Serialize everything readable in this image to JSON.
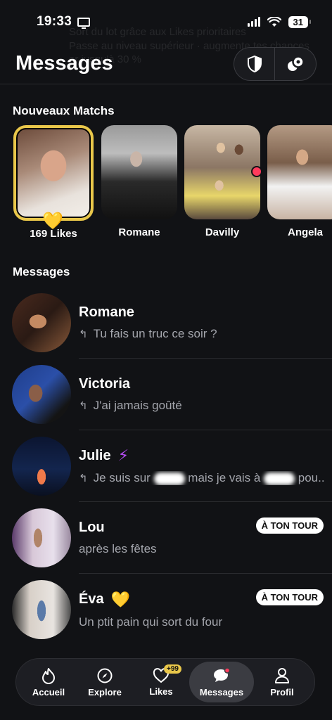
{
  "status_bar": {
    "time": "19:33",
    "battery": "31"
  },
  "header": {
    "title": "Messages",
    "ghost_banner_line1": "Sort du lot grâce aux Likes prioritaires",
    "ghost_banner_line2": "Passe au niveau supérieur · augmente tes chances",
    "ghost_banner_line3": "er jusqu'à 30 %",
    "shield_icon": "shield-icon",
    "connections_icon": "double-bubble-icon"
  },
  "new_matches": {
    "title": "Nouveaux Matchs",
    "items": [
      {
        "label": "169 Likes",
        "type": "likes"
      },
      {
        "label": "Romane"
      },
      {
        "label": "Davilly",
        "has_new": true
      },
      {
        "label": "Angela"
      }
    ]
  },
  "messages": {
    "title": "Messages",
    "rows": [
      {
        "name": "Romane",
        "preview": "Tu fais un truc ce soir ?",
        "replied": true
      },
      {
        "name": "Victoria",
        "preview": "J'ai jamais goûté",
        "replied": true
      },
      {
        "name": "Julie",
        "preview_a": "Je suis sur",
        "preview_b": "mais je vais à",
        "preview_c": "pou...",
        "replied": true,
        "badge": "boost"
      },
      {
        "name": "Lou",
        "preview": "après les fêtes",
        "turn_label": "À TON TOUR"
      },
      {
        "name": "Éva",
        "preview": "Un ptit pain qui sort du four",
        "turn_label": "À TON TOUR",
        "badge": "super-like"
      }
    ]
  },
  "nav": {
    "items": [
      {
        "label": "Accueil",
        "icon": "flame-icon"
      },
      {
        "label": "Explore",
        "icon": "compass-icon"
      },
      {
        "label": "Likes",
        "icon": "heart-icon",
        "badge": "+99"
      },
      {
        "label": "Messages",
        "icon": "chat-icon",
        "active": true
      },
      {
        "label": "Profil",
        "icon": "person-icon"
      }
    ]
  },
  "colors": {
    "background": "#111215",
    "gold": "#e9c74a",
    "boost_purple": "#b34cf0",
    "notification_red": "#ff3b5c"
  }
}
